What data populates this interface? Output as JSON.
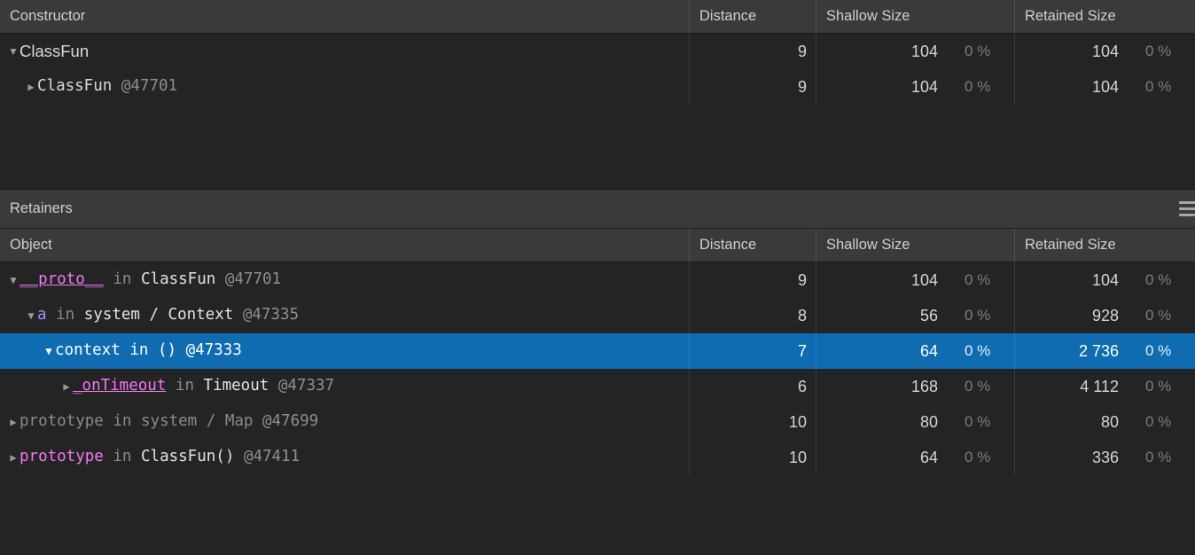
{
  "top_panel": {
    "columns": [
      {
        "key": "constructor",
        "label": "Constructor"
      },
      {
        "key": "distance",
        "label": "Distance"
      },
      {
        "key": "shallow",
        "label": "Shallow Size"
      },
      {
        "key": "retained",
        "label": "Retained Size"
      }
    ],
    "rows": [
      {
        "twisty": "▼",
        "depth": 0,
        "font": "sans",
        "name": "ClassFun",
        "in_label": "",
        "object": "",
        "id": "",
        "distance": "9",
        "shallow": "104",
        "shallow_pct": "0 %",
        "retained": "104",
        "retained_pct": "0 %",
        "selected": false
      },
      {
        "twisty": "▶",
        "depth": 1,
        "font": "mono",
        "name": "ClassFun",
        "in_label": "",
        "object": "",
        "id": "@47701",
        "distance": "9",
        "shallow": "104",
        "shallow_pct": "0 %",
        "retained": "104",
        "retained_pct": "0 %",
        "selected": false
      }
    ]
  },
  "retainers_section": {
    "title": "Retainers",
    "menu_icon": "hamburger-icon",
    "columns": [
      {
        "key": "object",
        "label": "Object"
      },
      {
        "key": "distance",
        "label": "Distance"
      },
      {
        "key": "shallow",
        "label": "Shallow Size"
      },
      {
        "key": "retained",
        "label": "Retained Size"
      }
    ],
    "rows": [
      {
        "twisty": "▼",
        "depth": 0,
        "prop": "__proto__",
        "prop_style": "prop underline",
        "in_label": "in",
        "object": "ClassFun",
        "object_style": "obj",
        "id": "@47701",
        "distance": "9",
        "shallow": "104",
        "shallow_pct": "0 %",
        "retained": "104",
        "retained_pct": "0 %",
        "selected": false
      },
      {
        "twisty": "▼",
        "depth": 1,
        "prop": "a",
        "prop_style": "prop2",
        "in_label": "in",
        "object": "system / Context",
        "object_style": "obj",
        "id": "@47335",
        "distance": "8",
        "shallow": "56",
        "shallow_pct": "0 %",
        "retained": "928",
        "retained_pct": "0 %",
        "selected": false
      },
      {
        "twisty": "▼",
        "depth": 2,
        "prop": "context",
        "prop_style": "plain",
        "in_label": "in",
        "object": "()",
        "object_style": "obj italic",
        "id": "@47333",
        "distance": "7",
        "shallow": "64",
        "shallow_pct": "0 %",
        "retained": "2 736",
        "retained_pct": "0 %",
        "selected": true
      },
      {
        "twisty": "▶",
        "depth": 3,
        "prop": "_onTimeout",
        "prop_style": "prop underline",
        "in_label": "in",
        "object": "Timeout",
        "object_style": "obj",
        "id": "@47337",
        "distance": "6",
        "shallow": "168",
        "shallow_pct": "0 %",
        "retained": "4 112",
        "retained_pct": "0 %",
        "selected": false
      },
      {
        "twisty": "▶",
        "depth": 0,
        "prop": "prototype",
        "prop_style": "dim",
        "in_label": "in",
        "object": "system / Map",
        "object_style": "dim",
        "id": "@47699",
        "distance": "10",
        "shallow": "80",
        "shallow_pct": "0 %",
        "retained": "80",
        "retained_pct": "0 %",
        "selected": false
      },
      {
        "twisty": "▶",
        "depth": 0,
        "prop": "prototype",
        "prop_style": "prop",
        "in_label": "in",
        "object": "ClassFun()",
        "object_style": "obj italic",
        "id": "@47411",
        "distance": "10",
        "shallow": "64",
        "shallow_pct": "0 %",
        "retained": "336",
        "retained_pct": "0 %",
        "selected": false
      }
    ]
  },
  "colors": {
    "header_bg": "#3a3a3a",
    "body_bg": "#242424",
    "selection_blue": "#0f6cb0",
    "property_magenta": "#f177f1",
    "property_violet": "#a88ffc",
    "dim_gray": "#8a8a8a"
  }
}
